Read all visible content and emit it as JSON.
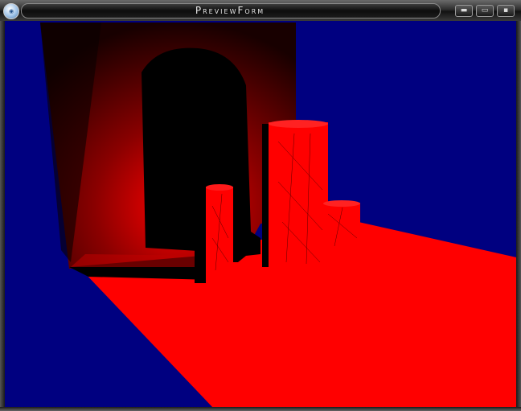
{
  "window": {
    "title": "PreviewForm",
    "icon": "app-logo-icon",
    "controls": [
      {
        "name": "minimize-button",
        "glyph": "▬"
      },
      {
        "name": "maximize-button",
        "glyph": "▭"
      },
      {
        "name": "close-button",
        "glyph": "▪"
      }
    ]
  },
  "scene": {
    "background_color": "#000080",
    "surface_color": "#ff0000",
    "shadow_color": "#000000"
  }
}
